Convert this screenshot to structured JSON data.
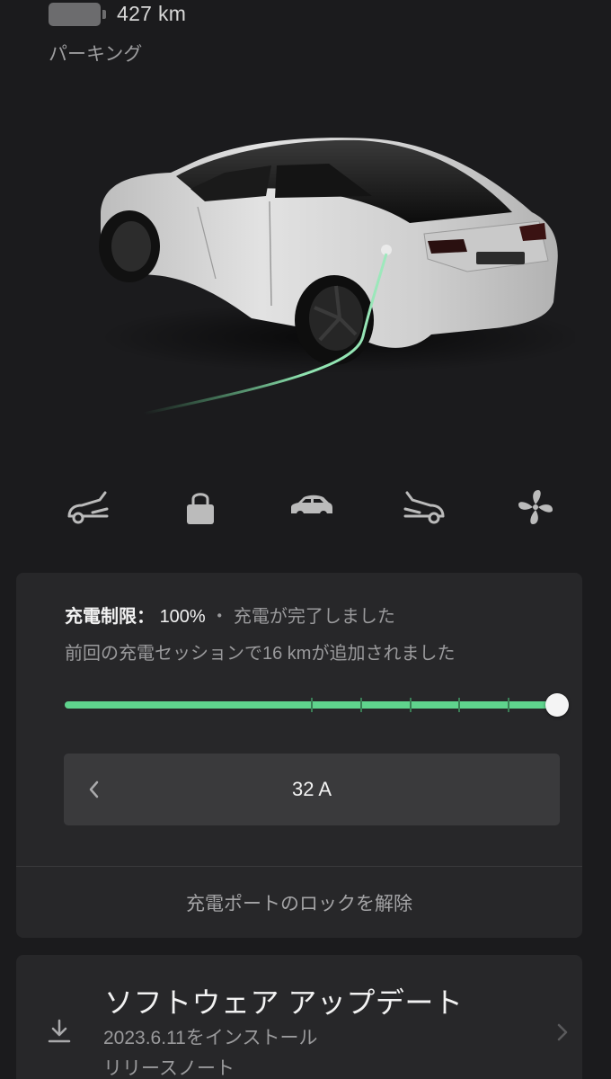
{
  "header": {
    "range": "427 km",
    "gear": "パーキング"
  },
  "quick_actions": [
    {
      "icon": "frunk-icon",
      "label": "フロントトランク"
    },
    {
      "icon": "lock-icon",
      "label": "ロック"
    },
    {
      "icon": "car-icon",
      "label": "車両"
    },
    {
      "icon": "trunk-icon",
      "label": "トランク"
    },
    {
      "icon": "fan-icon",
      "label": "エアコン"
    }
  ],
  "charge": {
    "limit_label": "充電制限：",
    "limit_value": "100%",
    "separator": "・",
    "status": "充電が完了しました",
    "added": "前回の充電セッションで16 kmが追加されました",
    "limit_fraction": 1.0,
    "tick_fractions": [
      0.5,
      0.6,
      0.7,
      0.8,
      0.9,
      1.0
    ],
    "amperage": "32 A",
    "unlock_label": "充電ポートのロックを解除",
    "accent_color": "#5fd38d"
  },
  "software": {
    "title": "ソフトウェア アップデート",
    "version_line": "2023.6.11をインストール",
    "notes_link": "リリースノート"
  }
}
